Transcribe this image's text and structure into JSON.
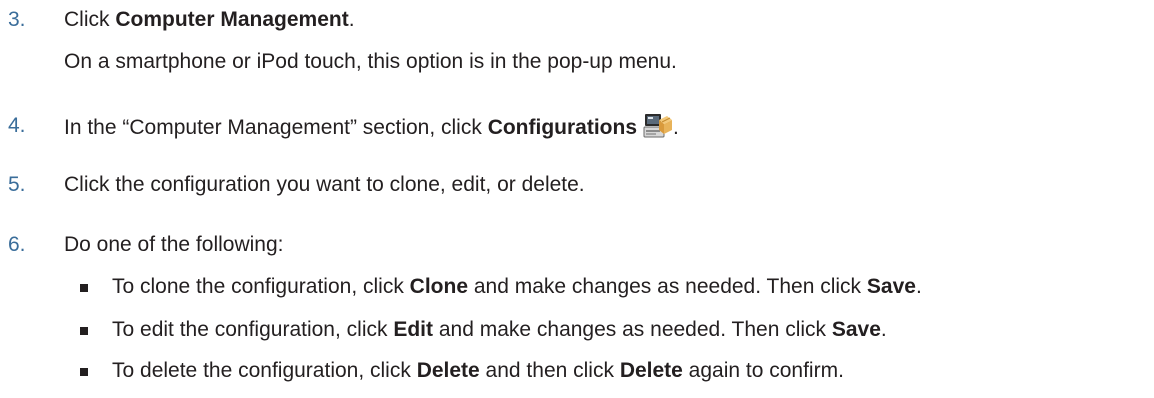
{
  "steps": [
    {
      "number": "3.",
      "pre": "Click ",
      "bold": "Computer Management",
      "post": ".",
      "note": "On a smartphone or iPod touch, this option is in the pop-up menu."
    },
    {
      "number": "4.",
      "pre": "In the “Computer Management” section, click ",
      "bold": "Configurations",
      "post": ".",
      "icon": "configurations-icon"
    },
    {
      "number": "5.",
      "text": "Click the configuration you want to clone, edit, or delete."
    },
    {
      "number": "6.",
      "text": "Do one of the following:",
      "bullets": [
        {
          "pre": "To clone the configuration, click ",
          "bold1": "Clone",
          "mid": " and make changes as needed. Then click ",
          "bold2": "Save",
          "post": "."
        },
        {
          "pre": "To edit the configuration, click ",
          "bold1": "Edit",
          "mid": " and make changes as needed. Then click ",
          "bold2": "Save",
          "post": "."
        },
        {
          "pre": "To delete the configuration, click ",
          "bold1": "Delete",
          "mid": " and then click ",
          "bold2": "Delete",
          "post": " again to confirm."
        }
      ]
    }
  ],
  "colors": {
    "number": "#3a6d9a",
    "text": "#231f20"
  }
}
